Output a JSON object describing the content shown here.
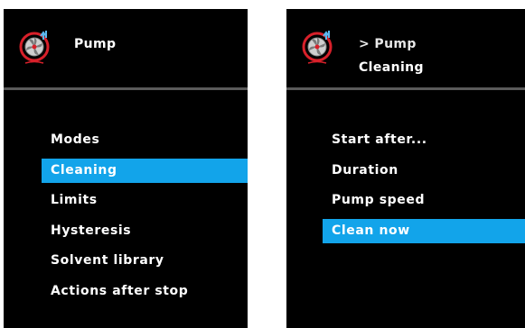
{
  "left_screen": {
    "logo_icon": "pump-fan-icon",
    "title": "Pump",
    "menu": [
      {
        "label": "Modes",
        "selected": false
      },
      {
        "label": "Cleaning",
        "selected": true
      },
      {
        "label": "Limits",
        "selected": false
      },
      {
        "label": "Hysteresis",
        "selected": false
      },
      {
        "label": "Solvent library",
        "selected": false
      },
      {
        "label": "Actions after stop",
        "selected": false
      }
    ]
  },
  "right_screen": {
    "logo_icon": "pump-fan-icon",
    "breadcrumb": "> Pump",
    "title": "Cleaning",
    "menu": [
      {
        "label": "Start after...",
        "selected": false
      },
      {
        "label": "Duration",
        "selected": false
      },
      {
        "label": "Pump speed",
        "selected": false
      },
      {
        "label": "Clean now",
        "selected": true
      }
    ]
  },
  "colors": {
    "screen_background": "#000000",
    "highlight": "#12a4ea",
    "logo_red": "#d8202a",
    "logo_blue": "#5bb8f0",
    "divider": "#5a5a5a"
  }
}
